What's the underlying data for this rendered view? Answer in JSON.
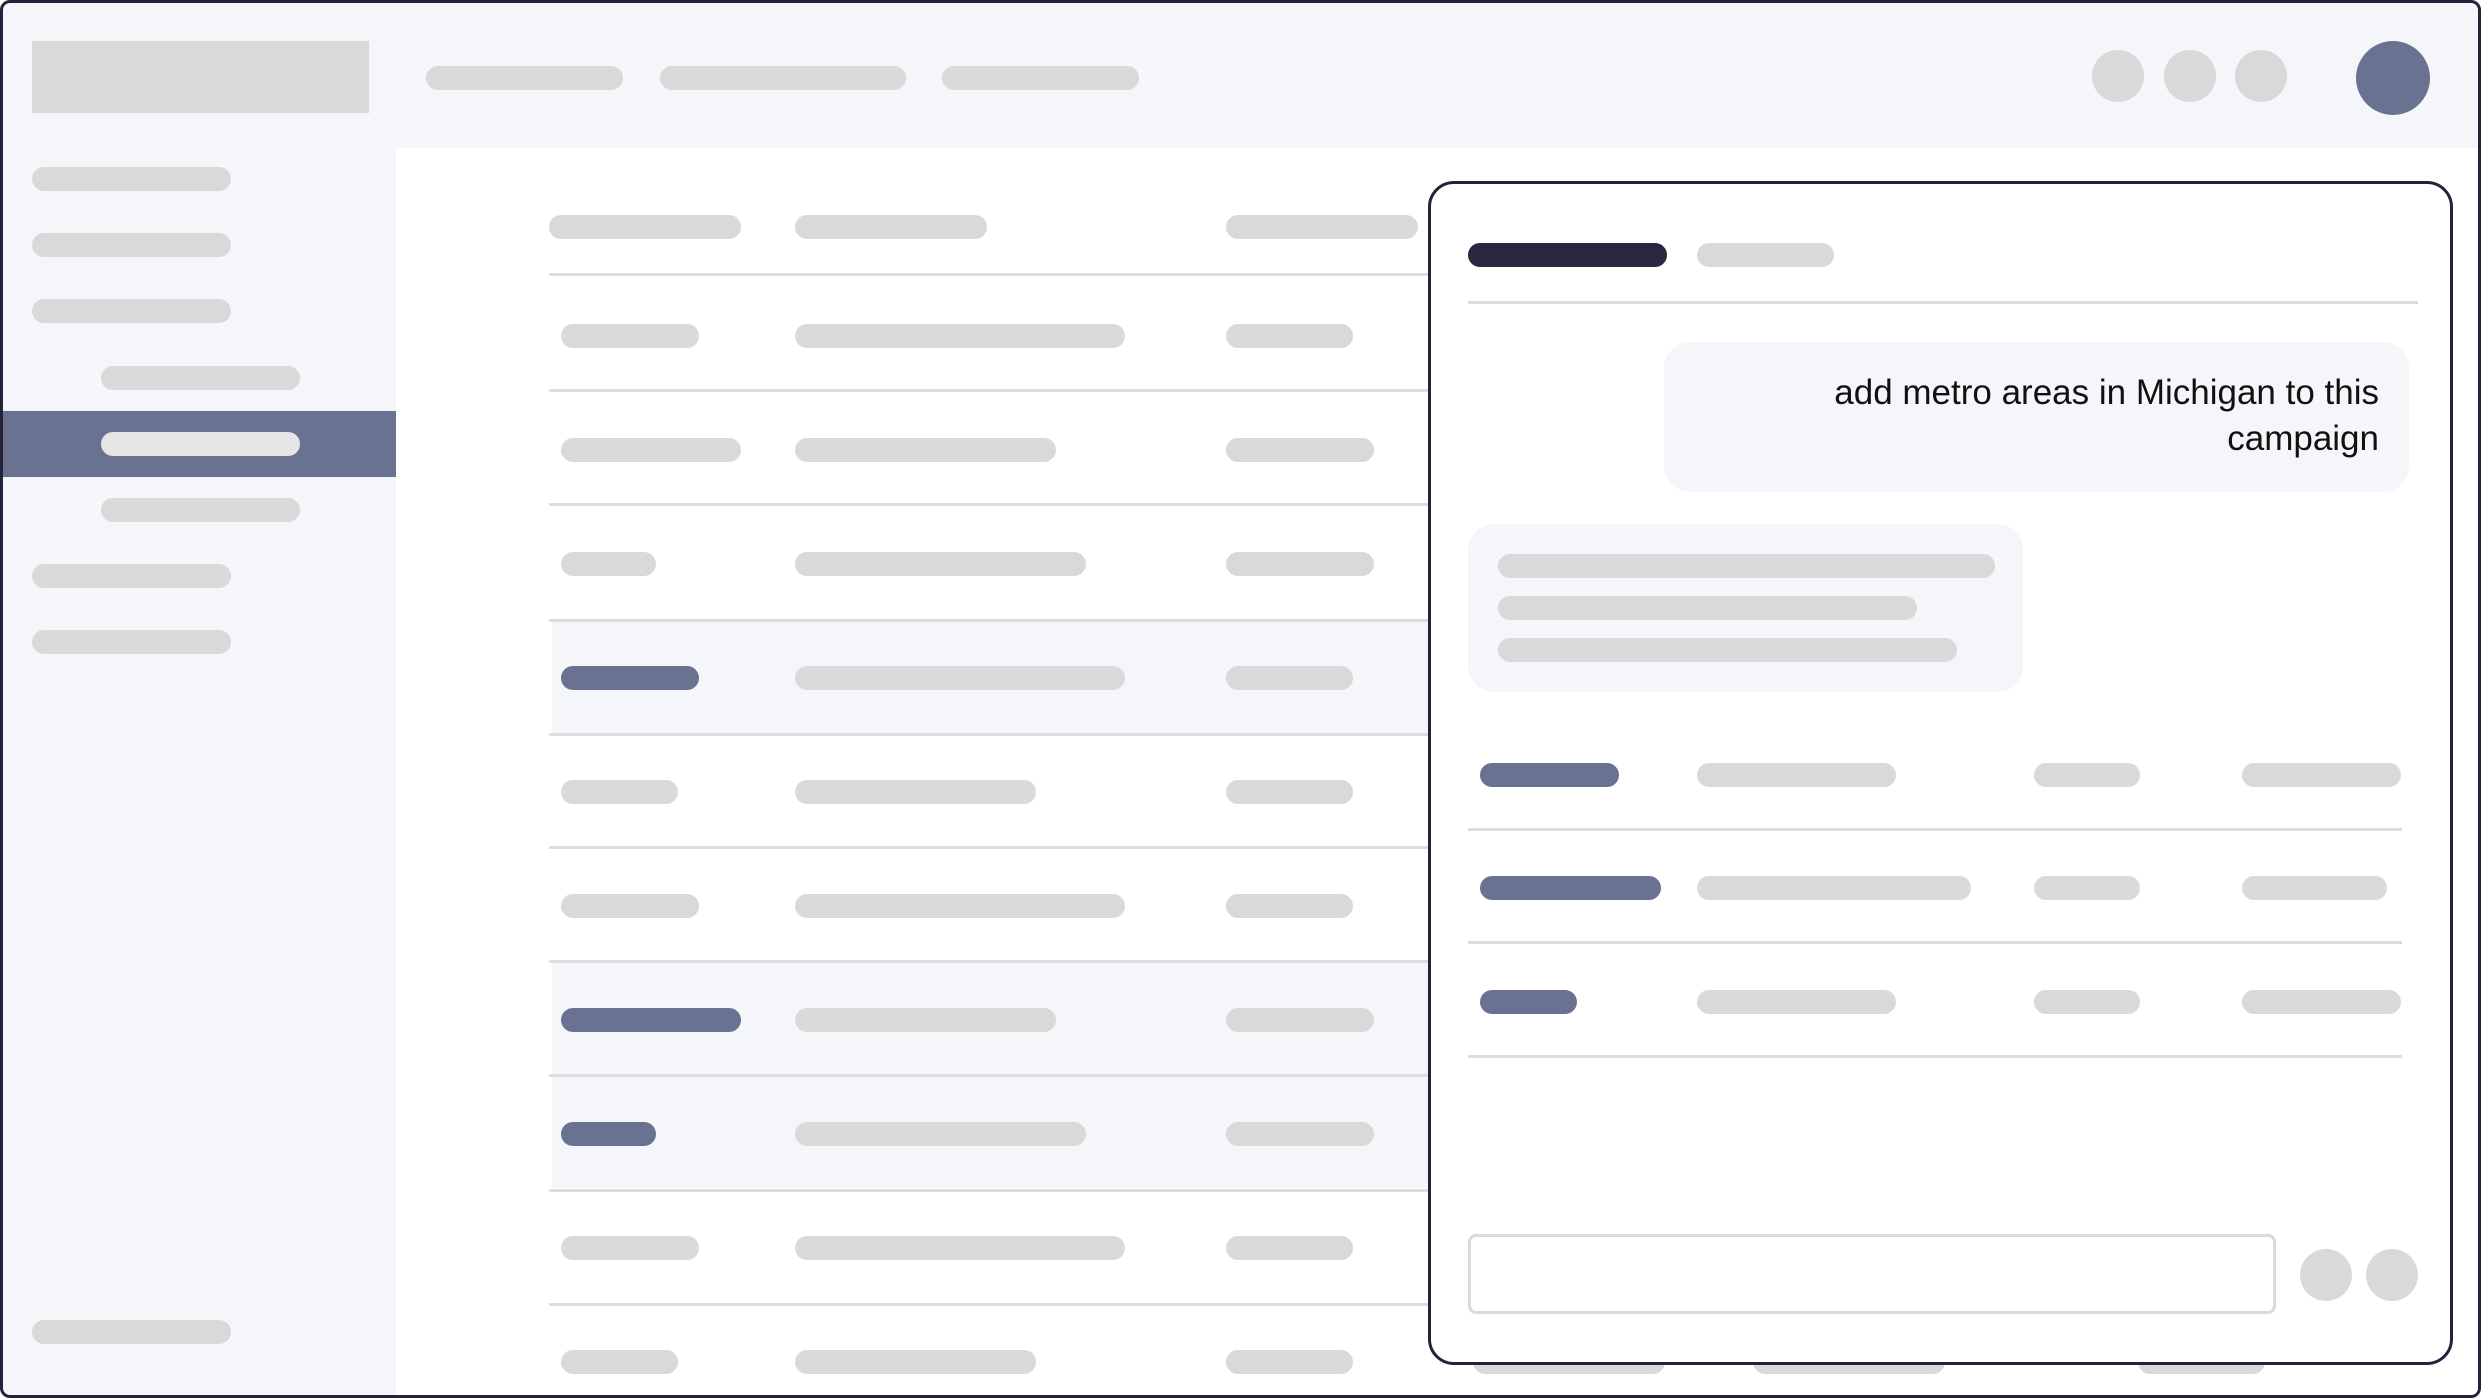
{
  "chat": {
    "user_message": "add metro areas in Michigan to this campaign",
    "input_placeholder": ""
  },
  "colors": {
    "accent": "#697391",
    "frame_border": "#24233a",
    "active_tab": "#2b2540",
    "placeholder": "#d9d9d9",
    "sidebar_background": "#f5f6fa",
    "highlighted_row": "#f5f6fa"
  },
  "icons": {
    "header_circles": [
      "placeholder-circle-icon",
      "placeholder-circle-icon",
      "placeholder-circle-icon"
    ],
    "avatar": "avatar-icon",
    "composer_buttons": [
      "placeholder-circle-icon",
      "placeholder-circle-icon"
    ]
  },
  "table": {
    "highlighted_rows": [
      4,
      7,
      8
    ]
  }
}
